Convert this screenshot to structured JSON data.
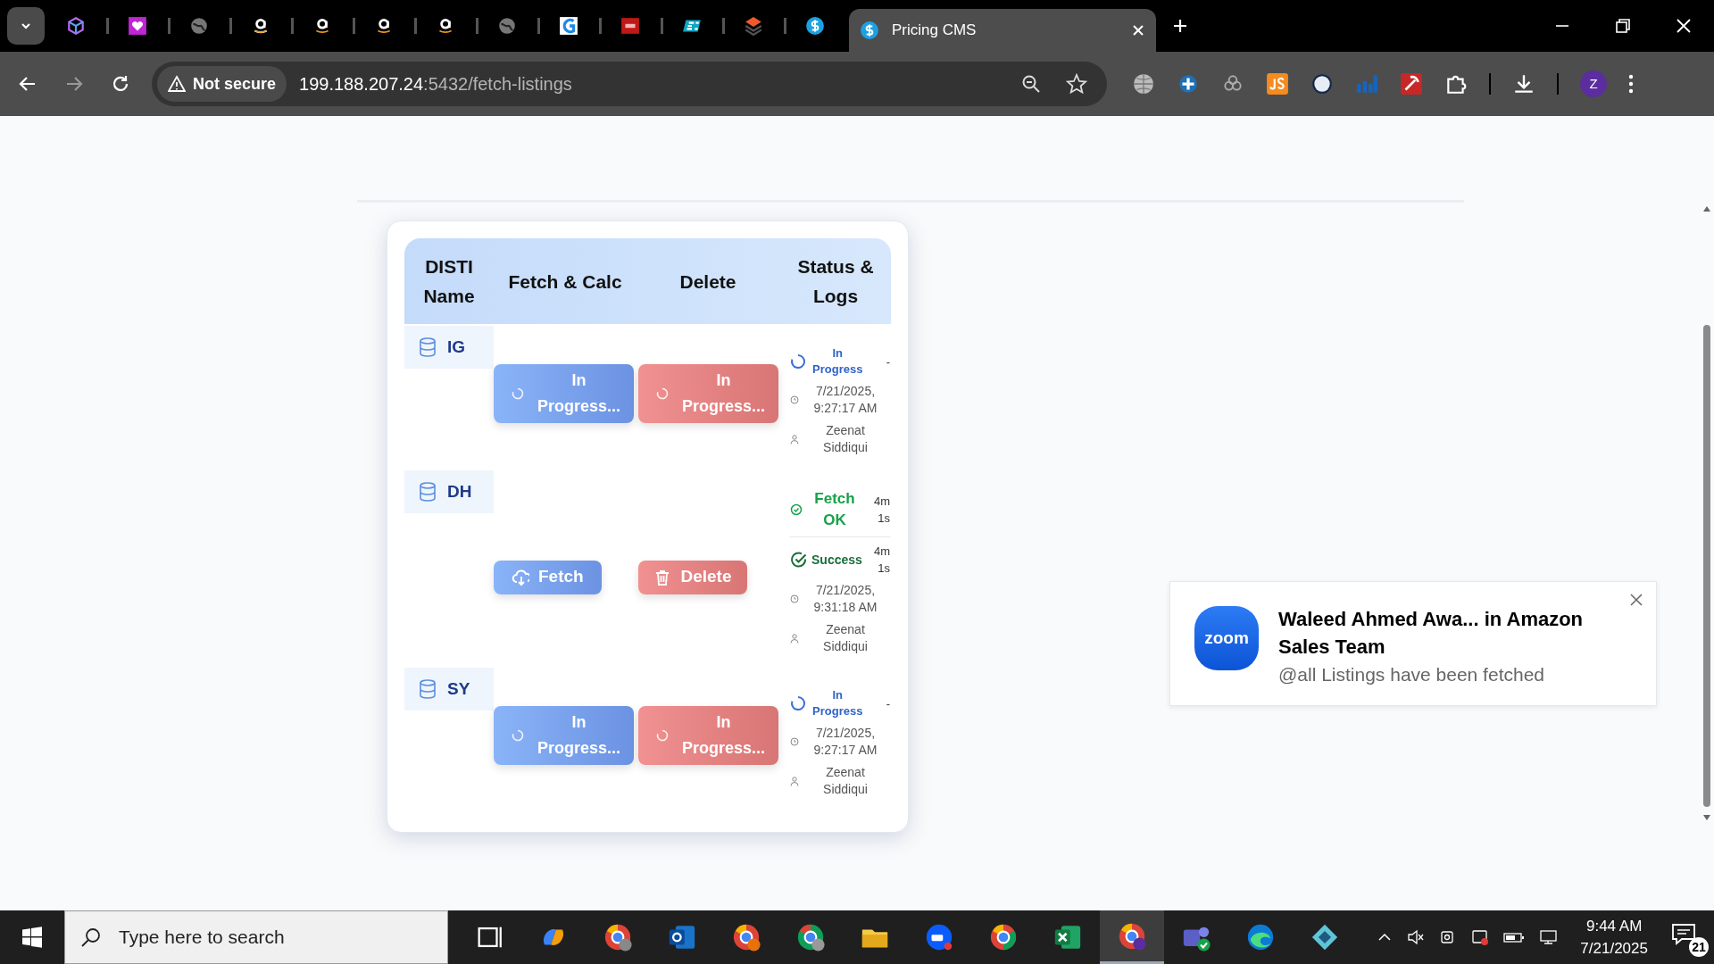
{
  "browser": {
    "tab_title": "Pricing CMS",
    "security": "Not secure",
    "url_host": "199.188.207.24",
    "url_path": ":5432/fetch-listings",
    "profile": "Z"
  },
  "table": {
    "columns": [
      "DISTI Name",
      "Fetch & Calc",
      "Delete",
      "Status & Logs"
    ],
    "rows": [
      {
        "name": "IG",
        "fetch": {
          "kind": "busy",
          "label": "In Progress..."
        },
        "delete": {
          "kind": "busy",
          "label": "In Progress..."
        },
        "logs": [
          {
            "kind": "progress",
            "status": "In Progress",
            "duration": "-",
            "time": "7/21/2025, 9:27:17 AM",
            "user": "Zeenat Siddiqui"
          }
        ]
      },
      {
        "name": "DH",
        "fetch": {
          "kind": "fetch",
          "label": "Fetch"
        },
        "delete": {
          "kind": "delete",
          "label": "Delete"
        },
        "logs": [
          {
            "kind": "ok",
            "status": "Fetch OK",
            "duration": "4m 1s"
          },
          {
            "kind": "success",
            "status": "Success",
            "duration": "4m 1s",
            "time": "7/21/2025, 9:31:18 AM",
            "user": "Zeenat Siddiqui"
          }
        ]
      },
      {
        "name": "SY",
        "fetch": {
          "kind": "busy",
          "label": "In Progress..."
        },
        "delete": {
          "kind": "busy",
          "label": "In Progress..."
        },
        "logs": [
          {
            "kind": "progress",
            "status": "In Progress",
            "duration": "-",
            "time": "7/21/2025, 9:27:17 AM",
            "user": "Zeenat Siddiqui"
          }
        ]
      }
    ]
  },
  "notification": {
    "logo": "zoom",
    "title": "Waleed Ahmed Awa... in Amazon Sales Team",
    "message": "@all Listings have been fetched"
  },
  "taskbar": {
    "search_placeholder": "Type here to search",
    "time": "9:44 AM",
    "date": "7/21/2025",
    "notifications": "21"
  }
}
